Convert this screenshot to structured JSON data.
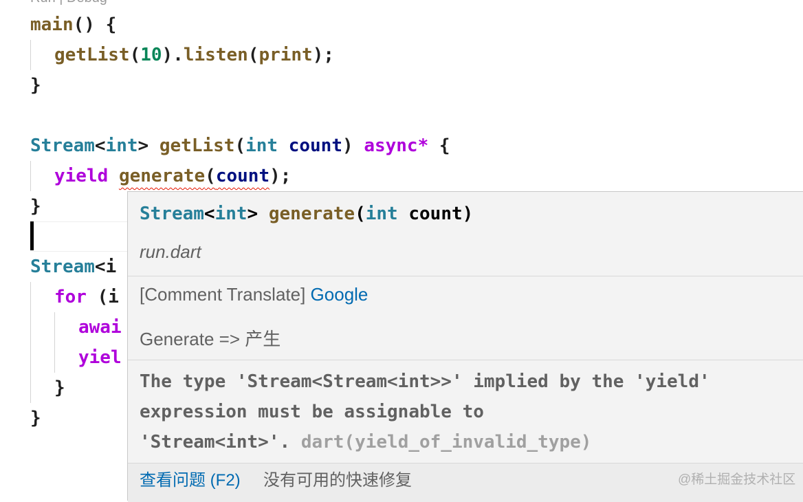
{
  "codelens": "Run | Debug",
  "code": {
    "line1": {
      "fn": "main",
      "rest": "() {"
    },
    "line2": {
      "fn": "getList",
      "p1": "(",
      "num": "10",
      "p2": ").",
      "fn2": "listen",
      "p3": "(",
      "fn3": "print",
      "p4": ");"
    },
    "line3": "}",
    "line5": {
      "ty1": "Stream",
      "lt": "<",
      "ty2": "int",
      "gt": "> ",
      "fn": "getList",
      "p1": "(",
      "ty3": "int",
      "sp": " ",
      "var": "count",
      "p2": ") ",
      "kw": "async*",
      "p3": " {"
    },
    "line6": {
      "kw": "yield",
      "sp": " ",
      "fn": "generate",
      "p1": "(",
      "var": "count",
      "p2": ");"
    },
    "line7": "}",
    "line9": {
      "ty": "Stream",
      "rest": "<i"
    },
    "line10": {
      "kw": "for",
      "rest": " (i"
    },
    "line11": {
      "kw": "awai"
    },
    "line12": {
      "kw": "yiel"
    },
    "line13": "}",
    "line14": "}"
  },
  "hover": {
    "signature": {
      "ty1": "Stream",
      "lt": "<",
      "ty2": "int",
      "gt": "> ",
      "fn": "generate",
      "p1": "(",
      "ty3": "int",
      "sp": " ",
      "param": "count",
      "p2": ")"
    },
    "file": "run.dart",
    "translate_prefix": "[Comment Translate] ",
    "translate_link": "Google",
    "translate_result": "Generate => 产生",
    "diagnostic": {
      "line1": "The type 'Stream<Stream<int>>' implied by the 'yield'",
      "line2": "expression must be assignable to",
      "line3": "'Stream<int>'. ",
      "source": "dart(yield_of_invalid_type)"
    },
    "status": {
      "view_problem": "查看问题 (F2)",
      "no_fix": "没有可用的快速修复"
    }
  },
  "watermark": "@稀土掘金技术社区"
}
